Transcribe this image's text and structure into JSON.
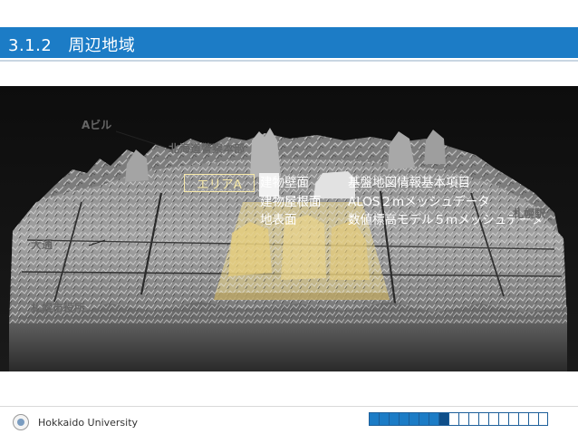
{
  "header": {
    "section_number": "3.1.2",
    "section_title": "周辺地域",
    "band_color": "#1c7cc6"
  },
  "figure": {
    "area_label": "エリアA",
    "legend": [
      {
        "surface": "建物壁面",
        "source": "基盤地図情報基本項目"
      },
      {
        "surface": "建物屋根面",
        "source": "ALOS２mメッシュデータ"
      },
      {
        "surface": "地表面",
        "source": "数値標高モデル５mメッシュデータ"
      }
    ],
    "places": {
      "a_building": "Aビル",
      "police_hq": "北海道警察本部",
      "odori": "大通",
      "sapporo_station": "札幌駅",
      "bottom_left": "札幌市役所"
    },
    "highlight_color": "#f2dc8c"
  },
  "footer": {
    "organization": "Hokkaido University",
    "progress": {
      "total_slides": 18,
      "current_slide": 8
    }
  }
}
